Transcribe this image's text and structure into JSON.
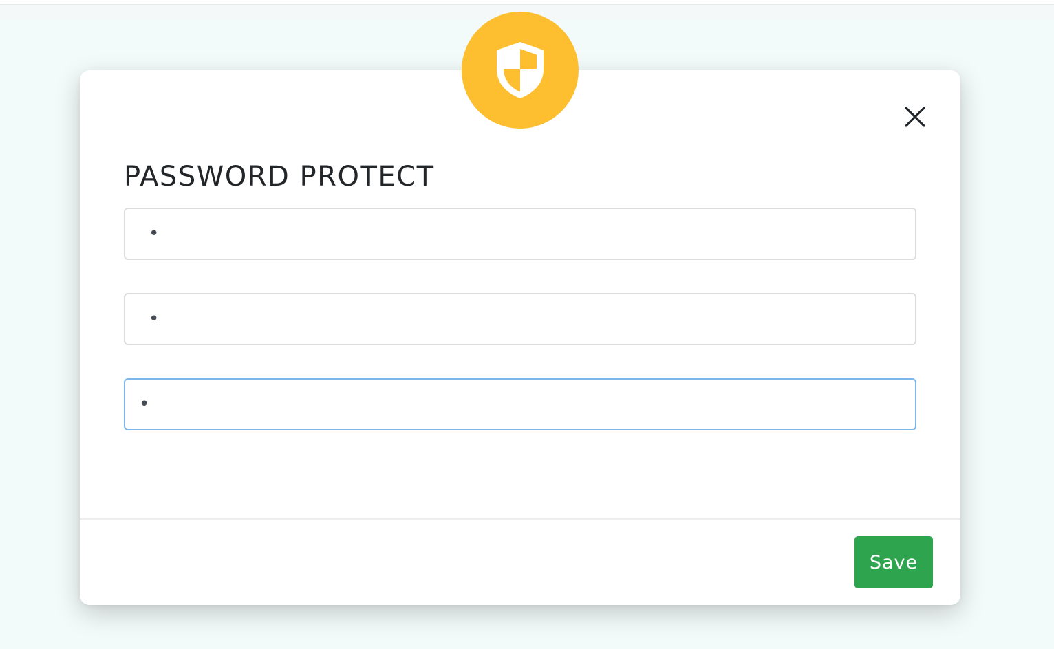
{
  "colors": {
    "badge": "#fdbf2f",
    "save_button": "#2ea44f",
    "focus_border": "#7fb6ea"
  },
  "modal": {
    "badge_icon": "shield-icon",
    "close_icon": "close-icon",
    "title": "PASSWORD PROTECT",
    "fields": [
      {
        "value": "•",
        "focused": false
      },
      {
        "value": "•",
        "focused": false
      },
      {
        "value": "•",
        "focused": true
      }
    ],
    "save_label": "Save"
  }
}
